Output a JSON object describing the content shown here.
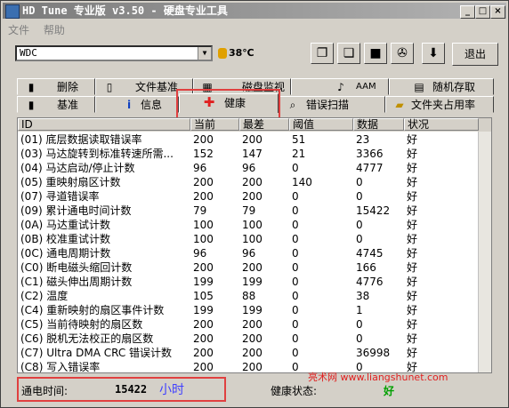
{
  "window": {
    "title": "HD Tune 专业版 v3.50 - 硬盘专业工具",
    "min_glyph": "_",
    "max_glyph": "□",
    "close_glyph": "×"
  },
  "menu": [
    "文件",
    "帮助"
  ],
  "toolbar": {
    "drive": "WDC",
    "temperature": "38℃",
    "exit_label": "退出",
    "tools": [
      "copy-icon",
      "paste-icon",
      "save-icon",
      "settings-icon",
      "down-arrow-icon"
    ]
  },
  "tabs_row1": [
    {
      "label": "删除",
      "icon": "trash-icon"
    },
    {
      "label": "文件基准",
      "icon": "file-benchmark-icon"
    },
    {
      "label": "磁盘监视器",
      "icon": "disk-monitor-icon"
    },
    {
      "label": "AAM",
      "icon": "speaker-icon"
    },
    {
      "label": "随机存取",
      "icon": "random-access-icon"
    }
  ],
  "tabs_row2": [
    {
      "label": "基准",
      "icon": "benchmark-icon"
    },
    {
      "label": "信息",
      "icon": "info-icon"
    },
    {
      "label": "健康",
      "icon": "health-cross-icon",
      "active": true
    },
    {
      "label": "错误扫描",
      "icon": "magnifier-icon"
    },
    {
      "label": "文件夹占用率",
      "icon": "folder-icon"
    }
  ],
  "table": {
    "headers": [
      "ID",
      "当前",
      "最差",
      "阈值",
      "数据",
      "状况"
    ],
    "rows": [
      [
        "(01) 底层数据读取错误率",
        "200",
        "200",
        "51",
        "23",
        "好"
      ],
      [
        "(03) 马达旋转到标准转速所需...",
        "152",
        "147",
        "21",
        "3366",
        "好"
      ],
      [
        "(04) 马达启动/停止计数",
        "96",
        "96",
        "0",
        "4777",
        "好"
      ],
      [
        "(05) 重映射扇区计数",
        "200",
        "200",
        "140",
        "0",
        "好"
      ],
      [
        "(07) 寻道错误率",
        "200",
        "200",
        "0",
        "0",
        "好"
      ],
      [
        "(09) 累计通电时间计数",
        "79",
        "79",
        "0",
        "15422",
        "好"
      ],
      [
        "(0A) 马达重试计数",
        "100",
        "100",
        "0",
        "0",
        "好"
      ],
      [
        "(0B) 校准重试计数",
        "100",
        "100",
        "0",
        "0",
        "好"
      ],
      [
        "(0C) 通电周期计数",
        "96",
        "96",
        "0",
        "4745",
        "好"
      ],
      [
        "(C0) 断电磁头缩回计数",
        "200",
        "200",
        "0",
        "166",
        "好"
      ],
      [
        "(C1) 磁头伸出周期计数",
        "199",
        "199",
        "0",
        "4776",
        "好"
      ],
      [
        "(C2) 温度",
        "105",
        "88",
        "0",
        "38",
        "好"
      ],
      [
        "(C4) 重新映射的扇区事件计数",
        "199",
        "199",
        "0",
        "1",
        "好"
      ],
      [
        "(C5) 当前待映射的扇区数",
        "200",
        "200",
        "0",
        "0",
        "好"
      ],
      [
        "(C6) 脱机无法校正的扇区数",
        "200",
        "200",
        "0",
        "0",
        "好"
      ],
      [
        "(C7) Ultra DMA CRC 错误计数",
        "200",
        "200",
        "0",
        "36998",
        "好"
      ],
      [
        "(C8) 写入错误率",
        "200",
        "200",
        "0",
        "0",
        "好"
      ]
    ]
  },
  "status": {
    "power_on_label": "通电时间:",
    "power_on_value": "15422",
    "power_on_unit": "小时",
    "health_label": "健康状态:",
    "health_value": "好"
  },
  "watermark": "亮术网 www.liangshunet.com"
}
